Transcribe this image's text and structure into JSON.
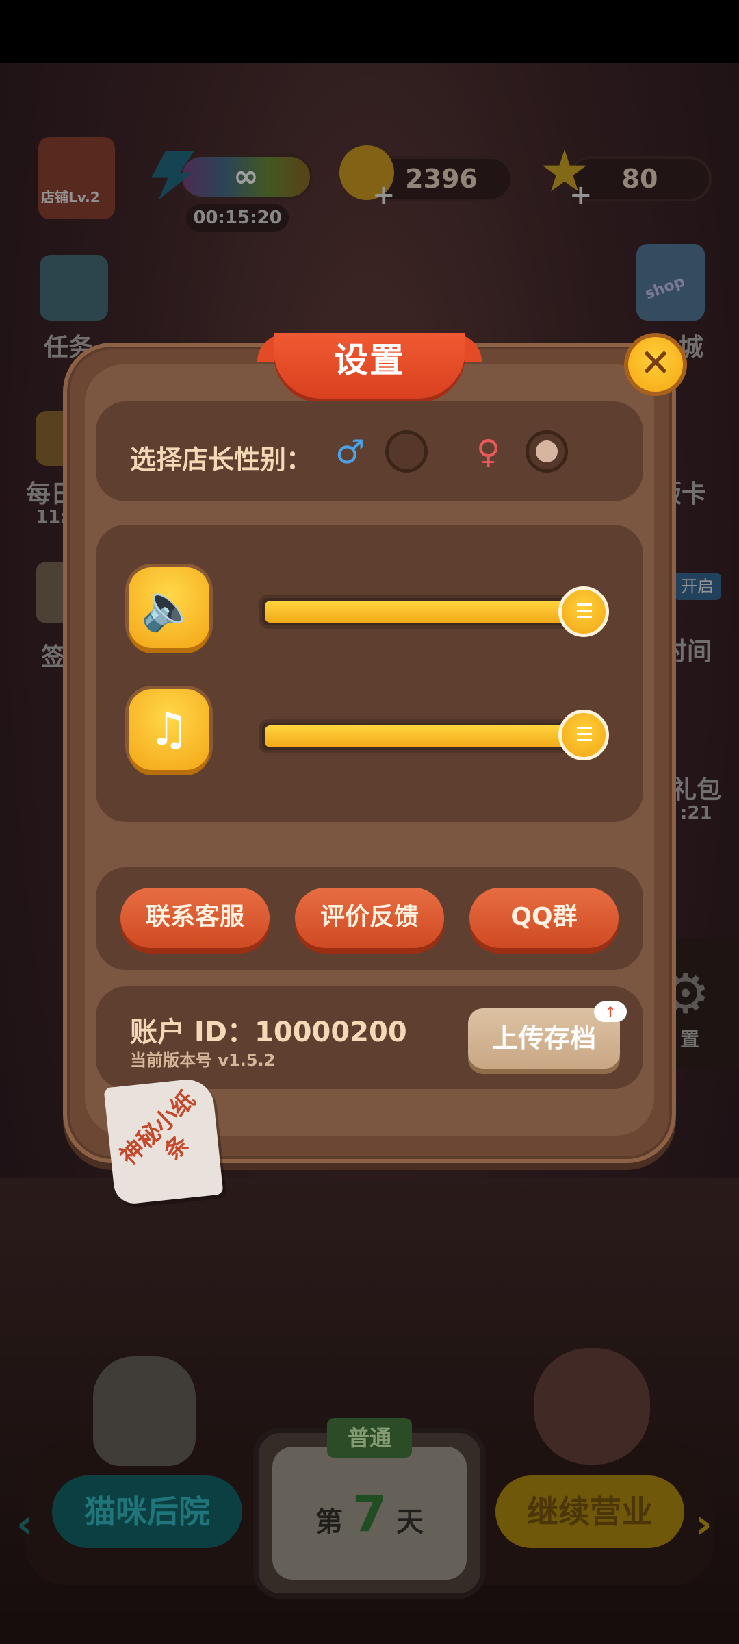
{
  "hud": {
    "shop_level": "店铺Lv.2",
    "energy_symbol": "∞",
    "energy_timer": "00:15:20",
    "coins": "2396",
    "stars": "80",
    "plus": "+"
  },
  "side_menu": {
    "tasks": "任务",
    "daily_partial": "每日",
    "daily_time_partial": "11:",
    "signin_partial": "签",
    "shop_badge": "shop",
    "city_partial": "城",
    "card_partial": "版卡",
    "open_badge": "开启",
    "time_partial": "时间",
    "gift_partial": "礼包",
    "gift_time_partial": ":21",
    "settings_partial": "置"
  },
  "settings": {
    "title": "设置",
    "close_symbol": "✕",
    "gender_label": "选择店长性别：",
    "male_symbol": "♂",
    "female_symbol": "♀",
    "selected_gender": "female",
    "sound_icon": "🔈",
    "music_icon": "♫",
    "sound_volume": 1.0,
    "music_volume": 1.0,
    "buttons": {
      "contact": "联系客服",
      "feedback": "评价反馈",
      "qq_group": "QQ群"
    },
    "account_id": "账户 ID：10000200",
    "version": "当前版本号 v1.5.2",
    "upload": "上传存档",
    "upload_badge": "↑"
  },
  "note": {
    "text": "神秘小纸条"
  },
  "bottom": {
    "backyard": "猫咪后院",
    "difficulty": "普通",
    "day_prefix": "第",
    "day_number": "7",
    "day_suffix": "天",
    "continue": "继续营业",
    "left_arrow": "‹",
    "right_arrow": "›"
  }
}
